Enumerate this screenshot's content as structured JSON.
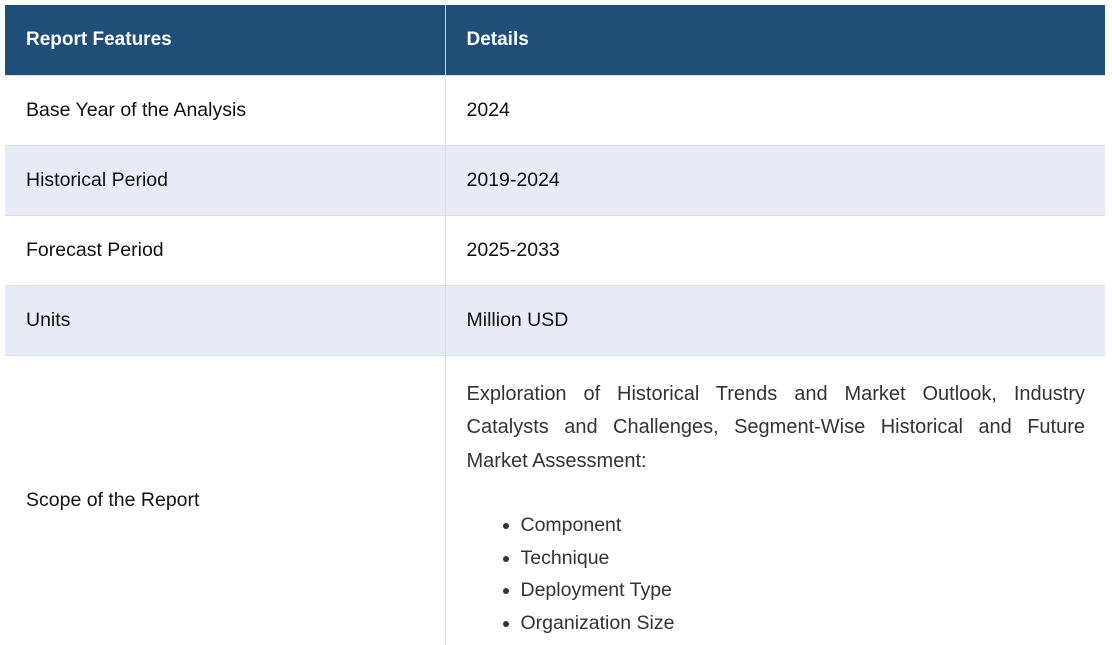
{
  "table": {
    "headers": [
      "Report Features",
      "Details"
    ],
    "rows": [
      {
        "feature": "Base Year of the Analysis",
        "detail": "2024"
      },
      {
        "feature": "Historical Period",
        "detail": "2019-2024"
      },
      {
        "feature": "Forecast Period",
        "detail": "2025-2033"
      },
      {
        "feature": "Units",
        "detail": "Million USD"
      }
    ],
    "scope": {
      "feature": "Scope of the Report",
      "intro": "Exploration of Historical Trends and Market Outlook, Industry Catalysts and Challenges, Segment-Wise Historical and Future Market Assessment:",
      "items": [
        "Component",
        "Technique",
        "Deployment Type",
        "Organization Size"
      ]
    }
  },
  "colors": {
    "header_bg": "#1f4e79",
    "alt_row_bg": "#e8eaf5"
  }
}
